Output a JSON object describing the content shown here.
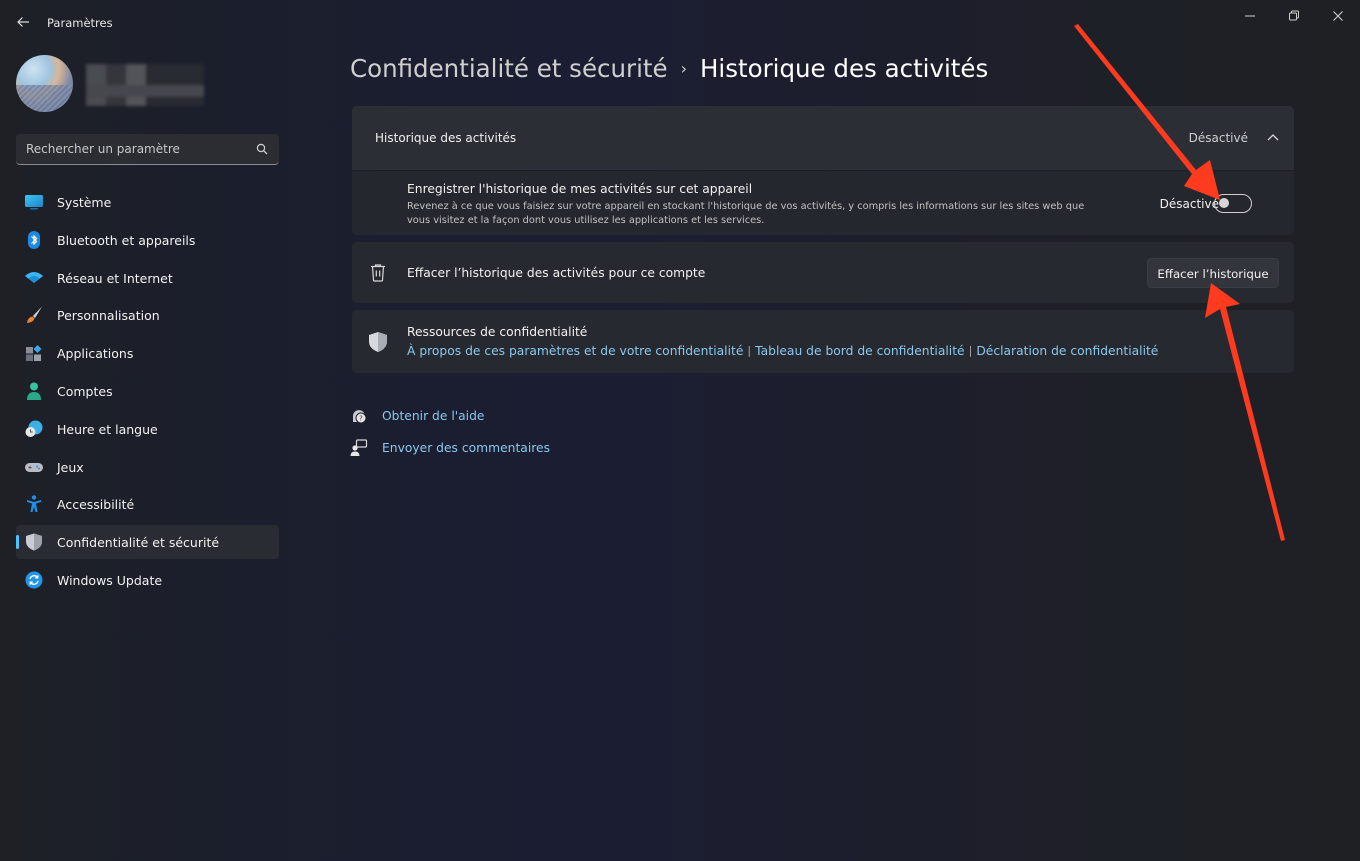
{
  "window": {
    "title": "Paramètres",
    "controls": {
      "minimize": "minimize",
      "maximize": "restore",
      "close": "close"
    }
  },
  "profile": {
    "name_redacted": true
  },
  "search": {
    "placeholder": "Rechercher un paramètre"
  },
  "sidebar": {
    "items": [
      {
        "label": "Système",
        "icon": "monitor-icon"
      },
      {
        "label": "Bluetooth et appareils",
        "icon": "bluetooth-icon"
      },
      {
        "label": "Réseau et Internet",
        "icon": "wifi-icon"
      },
      {
        "label": "Personnalisation",
        "icon": "brush-icon"
      },
      {
        "label": "Applications",
        "icon": "apps-icon"
      },
      {
        "label": "Comptes",
        "icon": "person-icon"
      },
      {
        "label": "Heure et langue",
        "icon": "clock-globe-icon"
      },
      {
        "label": "Jeux",
        "icon": "gamepad-icon"
      },
      {
        "label": "Accessibilité",
        "icon": "accessibility-icon"
      },
      {
        "label": "Confidentialité et sécurité",
        "icon": "shield-icon",
        "active": true
      },
      {
        "label": "Windows Update",
        "icon": "update-icon"
      }
    ]
  },
  "breadcrumb": {
    "parent": "Confidentialité et sécurité",
    "separator": "›",
    "current": "Historique des activités"
  },
  "activity_history": {
    "header_title": "Historique des activités",
    "header_status": "Désactivé",
    "expanded": true,
    "record_setting": {
      "title": "Enregistrer l'historique de mes activités sur cet appareil",
      "description": "Revenez à ce que vous faisiez sur votre appareil en stockant l'historique de vos activités, y compris les informations sur les sites web que vous visitez et la façon dont vous utilisez les applications et les services.",
      "toggle_label": "Désactivé",
      "toggle_on": false
    }
  },
  "clear_history": {
    "text": "Effacer l’historique des activités pour ce compte",
    "button_label": "Effacer l’historique"
  },
  "privacy_resources": {
    "title": "Ressources de confidentialité",
    "links": [
      "À propos de ces paramètres et de votre confidentialité",
      "Tableau de bord de confidentialité",
      "Déclaration de confidentialité"
    ],
    "separator": "|"
  },
  "help_links": [
    {
      "label": "Obtenir de l'aide",
      "icon": "help-icon"
    },
    {
      "label": "Envoyer des commentaires",
      "icon": "feedback-icon"
    }
  ],
  "annotations": {
    "arrow_color": "#ff3b1f"
  },
  "colors": {
    "accent": "#4cc2ff",
    "link": "#8bc8ec"
  }
}
